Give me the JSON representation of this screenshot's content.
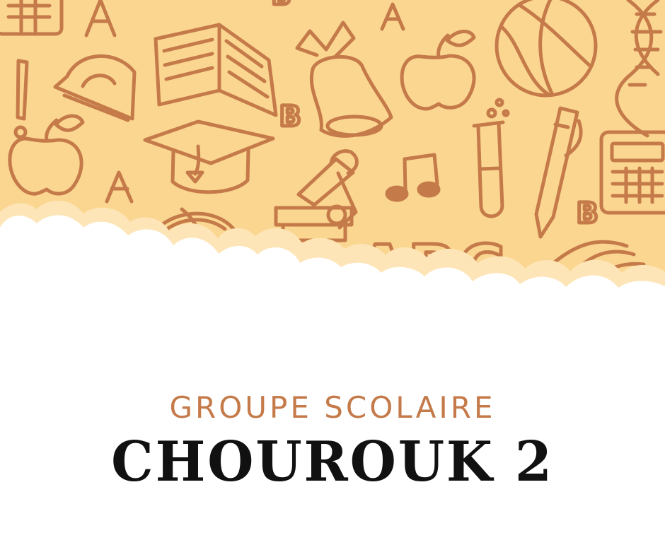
{
  "colors": {
    "background_pattern": "#fbd690",
    "doodle_stroke": "#c57a4a",
    "cloud": "#ffffff",
    "subtitle": "#c57a4a",
    "title": "#111111"
  },
  "decorative_icons": [
    "calculator-icon",
    "triangle-letter-a-icon",
    "letter-b-icon",
    "exclamation-icon",
    "protractor-icon",
    "open-book-icon",
    "school-bell-icon",
    "apple-icon",
    "basketball-icon",
    "dna-icon",
    "graduation-cap-icon",
    "microscope-icon",
    "music-note-icon",
    "test-tube-icon",
    "pencil-icon",
    "abc-letters-icon",
    "globe-icon"
  ],
  "doodle_letters": {
    "letter_a_1": "A",
    "letter_a_2": "A",
    "letter_b_1": "B",
    "letter_b_2": "B",
    "abc": "ABC"
  },
  "subtitle": "GROUPE SCOLAIRE",
  "title": "CHOUROUK 2"
}
